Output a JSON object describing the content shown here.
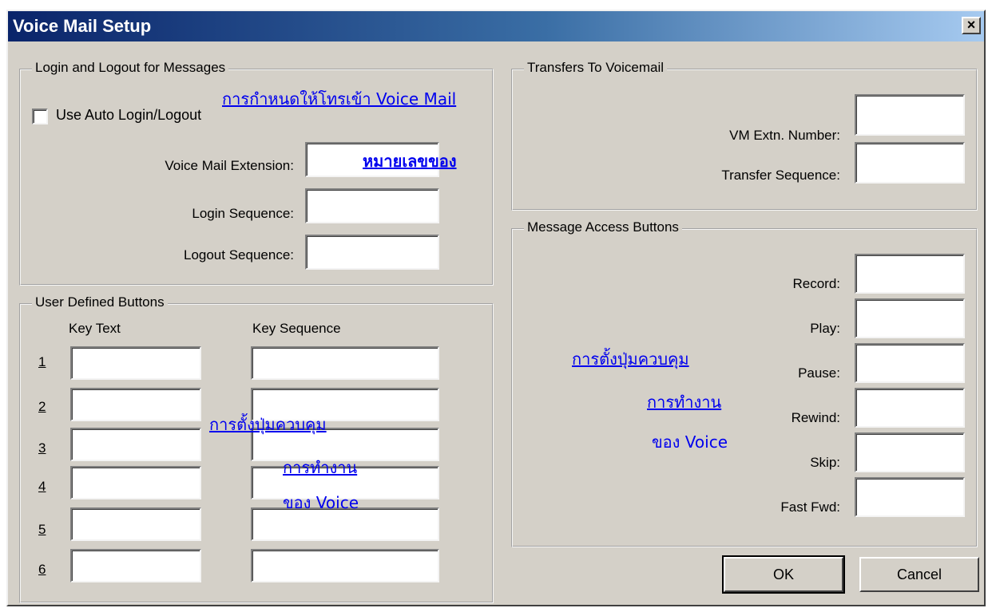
{
  "window": {
    "title": "Voice Mail Setup",
    "close_glyph": "×"
  },
  "login_group": {
    "legend": "Login and Logout for Messages",
    "auto_login_label": "Use Auto Login/Logout",
    "voice_mail_extension_label": "Voice Mail Extension:",
    "login_sequence_label": "Login Sequence:",
    "logout_sequence_label": "Logout Sequence:"
  },
  "transfers_group": {
    "legend": "Transfers To Voicemail",
    "vm_extn_label": "VM Extn. Number:",
    "transfer_sequence_label": "Transfer Sequence:"
  },
  "user_buttons_group": {
    "legend": "User Defined Buttons",
    "key_text_header": "Key Text",
    "key_sequence_header": "Key Sequence",
    "rows": [
      "1",
      "2",
      "3",
      "4",
      "5",
      "6"
    ]
  },
  "message_access_group": {
    "legend": "Message Access Buttons",
    "record_label": "Record:",
    "play_label": "Play:",
    "pause_label": "Pause:",
    "rewind_label": "Rewind:",
    "skip_label": "Skip:",
    "fast_fwd_label": "Fast Fwd:"
  },
  "buttons": {
    "ok": "OK",
    "cancel": "Cancel"
  },
  "annotations": {
    "voice_mail_setup": "การกำหนดให้โทรเข้า Voice Mail",
    "number_of": "หมายเลขของ",
    "user_line1": "การตั้งปุ่มควบคุม",
    "user_line2": "การทำงาน",
    "user_line3": "ของ Voice",
    "msg_line1": "การตั้งปุ่มควบคุม",
    "msg_line2": "การทำงาน",
    "msg_line3": "ของ Voice"
  }
}
